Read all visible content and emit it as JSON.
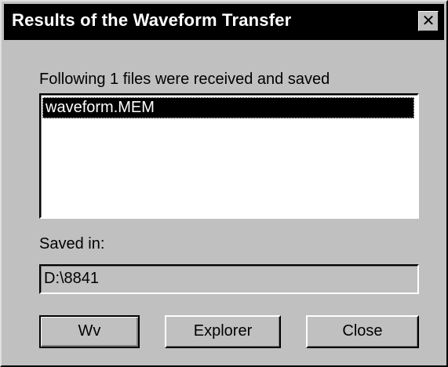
{
  "dialog": {
    "title": "Results of the Waveform Transfer",
    "close_glyph": "✕"
  },
  "files": {
    "label": "Following 1 files were received and saved",
    "items": [
      "waveform.MEM"
    ],
    "selected_index": 0
  },
  "saved_in": {
    "label": "Saved in:",
    "value": "D:\\8841"
  },
  "buttons": {
    "wv": "Wv",
    "explorer": "Explorer",
    "close": "Close"
  }
}
